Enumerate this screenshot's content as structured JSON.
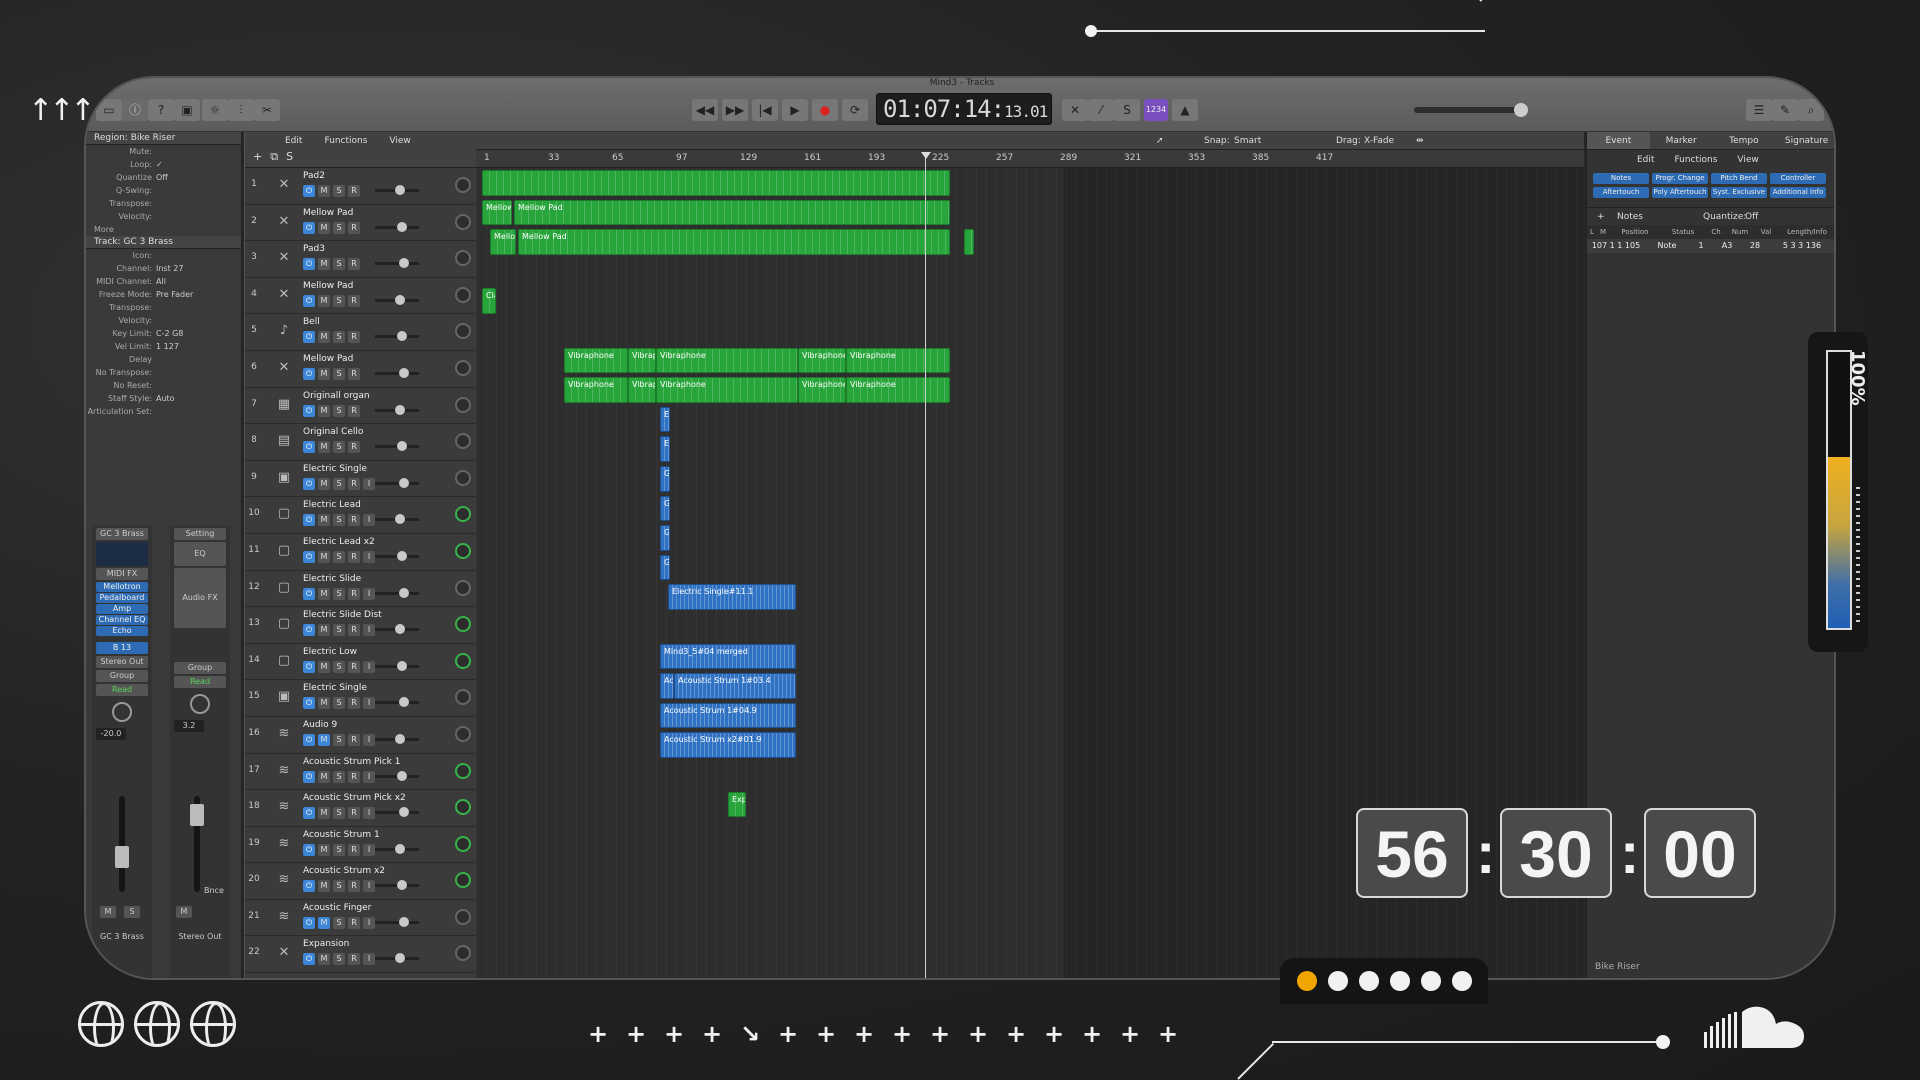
{
  "window_title": "Mind3 - Tracks",
  "lcd": {
    "main": "01:07:14:",
    "sub": "13.01"
  },
  "count_in": "1234",
  "timer": {
    "hours": "56",
    "minutes": "30",
    "seconds": "00"
  },
  "meter": {
    "label": "100%",
    "level": 0.62
  },
  "accent_color": "#f0a500",
  "region_colors": {
    "midi": "#27a53a",
    "audio": "#2f71c2"
  },
  "inspector": {
    "region_header": "Region: Bike Riser",
    "region_rows": [
      {
        "k": "Mute:",
        "v": ""
      },
      {
        "k": "Loop:",
        "v": "✓"
      },
      {
        "k": "Quantize",
        "v": "Off"
      },
      {
        "k": "Q-Swing:",
        "v": ""
      },
      {
        "k": "Transpose:",
        "v": ""
      },
      {
        "k": "Velocity:",
        "v": ""
      }
    ],
    "more": "More",
    "track_header": "Track: GC 3 Brass",
    "track_rows": [
      {
        "k": "Icon:",
        "v": ""
      },
      {
        "k": "Channel:",
        "v": "Inst 27"
      },
      {
        "k": "MIDI Channel:",
        "v": "All"
      },
      {
        "k": "Freeze Mode:",
        "v": "Pre Fader"
      },
      {
        "k": "Transpose:",
        "v": ""
      },
      {
        "k": "Velocity:",
        "v": ""
      },
      {
        "k": "Key Limit:",
        "v": "C-2 G8"
      },
      {
        "k": "Vel Limit:",
        "v": "1 127"
      },
      {
        "k": "Delay",
        "v": ""
      },
      {
        "k": "No Transpose:",
        "v": ""
      },
      {
        "k": "No Reset:",
        "v": ""
      },
      {
        "k": "Staff Style:",
        "v": "Auto"
      },
      {
        "k": "Articulation Set:",
        "v": ""
      }
    ],
    "strip_left": {
      "name": "GC 3 Brass",
      "midi_fx": "MIDI FX",
      "plugins": [
        "Mellotron",
        "Pedalboard",
        "Amp",
        "Channel EQ",
        "Echo"
      ],
      "send": "B 13",
      "output": "Stereo Out",
      "group": "Group",
      "automation": "Read",
      "value": "-20.0",
      "ms": [
        "M",
        "S"
      ],
      "footer": "GC 3 Brass"
    },
    "strip_right": {
      "setting": "Setting",
      "eq": "EQ",
      "audio_fx": "Audio FX",
      "group": "Group",
      "automation": "Read",
      "value": "3.2",
      "bounce": "Bnce",
      "ms": [
        "M"
      ],
      "footer": "Stereo Out"
    }
  },
  "arrange_menu": {
    "edit": "Edit",
    "functions": "Functions",
    "view": "View",
    "snap_label": "Snap:",
    "snap_value": "Smart",
    "drag_label": "Drag:",
    "drag_value": "X-Fade"
  },
  "ruler": [
    "1",
    "33",
    "65",
    "97",
    "129",
    "161",
    "193",
    "225",
    "257",
    "289",
    "321",
    "353",
    "385",
    "417"
  ],
  "tracks": [
    {
      "n": "1",
      "name": "Pad2",
      "icon": "✕"
    },
    {
      "n": "2",
      "name": "Mellow Pad",
      "icon": "✕"
    },
    {
      "n": "3",
      "name": "Pad3",
      "icon": "✕"
    },
    {
      "n": "4",
      "name": "Mellow Pad",
      "icon": "✕"
    },
    {
      "n": "5",
      "name": "Bell",
      "icon": "♪"
    },
    {
      "n": "6",
      "name": "Mellow Pad",
      "icon": "✕"
    },
    {
      "n": "7",
      "name": "Originall organ",
      "icon": "▦"
    },
    {
      "n": "8",
      "name": "Original Cello",
      "icon": "▤"
    },
    {
      "n": "9",
      "name": "Electric Single",
      "icon": "▣"
    },
    {
      "n": "10",
      "name": "Electric Lead",
      "icon": "▢"
    },
    {
      "n": "11",
      "name": "Electric Lead x2",
      "icon": "▢"
    },
    {
      "n": "12",
      "name": "Electric Slide",
      "icon": "▢"
    },
    {
      "n": "13",
      "name": "Electric Slide Dist",
      "icon": "▢"
    },
    {
      "n": "14",
      "name": "Electric Low",
      "icon": "▢"
    },
    {
      "n": "15",
      "name": "Electric Single",
      "icon": "▣"
    },
    {
      "n": "16",
      "name": "Audio 9",
      "icon": "≋"
    },
    {
      "n": "17",
      "name": "Acoustic Strum Pick 1",
      "icon": "≋"
    },
    {
      "n": "18",
      "name": "Acoustic Strum Pick x2",
      "icon": "≋"
    },
    {
      "n": "19",
      "name": "Acoustic Strum 1",
      "icon": "≋"
    },
    {
      "n": "20",
      "name": "Acoustic Strum x2",
      "icon": "≋"
    },
    {
      "n": "21",
      "name": "Acoustic Finger",
      "icon": "≋"
    },
    {
      "n": "22",
      "name": "Expansion",
      "icon": "✕"
    }
  ],
  "track_buttons": {
    "m": "M",
    "s": "S",
    "r": "R",
    "i": "I"
  },
  "regions": {
    "mellow_p": "Mellow P",
    "mellow_pad": "Mellow Pad",
    "mellow": "Mellow",
    "clas": "Clas",
    "vibraphone": "Vibraphone",
    "vibraph": "Vibraph",
    "el": "El",
    "e": "E",
    "g": "G",
    "gu": "Gu",
    "electric_single": "Electric Single#11.1",
    "merged": "Mind3_5#04 merged",
    "ac": "Ac",
    "strum1": "Acoustic Strum 1#03.4",
    "strum2": "Acoustic Strum 1#04.9",
    "strum3": "Acoustic Strum x2#01.9",
    "expa": "Expa"
  },
  "event_list": {
    "tabs": [
      "Event",
      "Marker",
      "Tempo",
      "Signature"
    ],
    "menu": [
      "Edit",
      "Functions",
      "View"
    ],
    "filters": [
      "Notes",
      "Progr. Change",
      "Pitch Bend",
      "Controller",
      "Aftertouch",
      "Poly Aftertouch",
      "Syst. Exclusive",
      "Additional Info"
    ],
    "notes_label": "Notes",
    "quantize_label": "Quantize:",
    "quantize_value": "Off",
    "columns": [
      "L",
      "M",
      "Position",
      "Status",
      "Ch",
      "Num",
      "Val",
      "Length/Info"
    ],
    "row": {
      "position": "107 1 1 105",
      "status": "Note",
      "ch": "1",
      "num": "A3",
      "val": "28",
      "length": "5 3 3 136"
    },
    "footer": "Bike Riser"
  },
  "overlay": {
    "plus_marks": [
      "+",
      "+",
      "+",
      "+",
      "↘",
      "+",
      "+",
      "+",
      "+",
      "+",
      "+",
      "+",
      "+",
      "+",
      "+",
      "+"
    ]
  }
}
